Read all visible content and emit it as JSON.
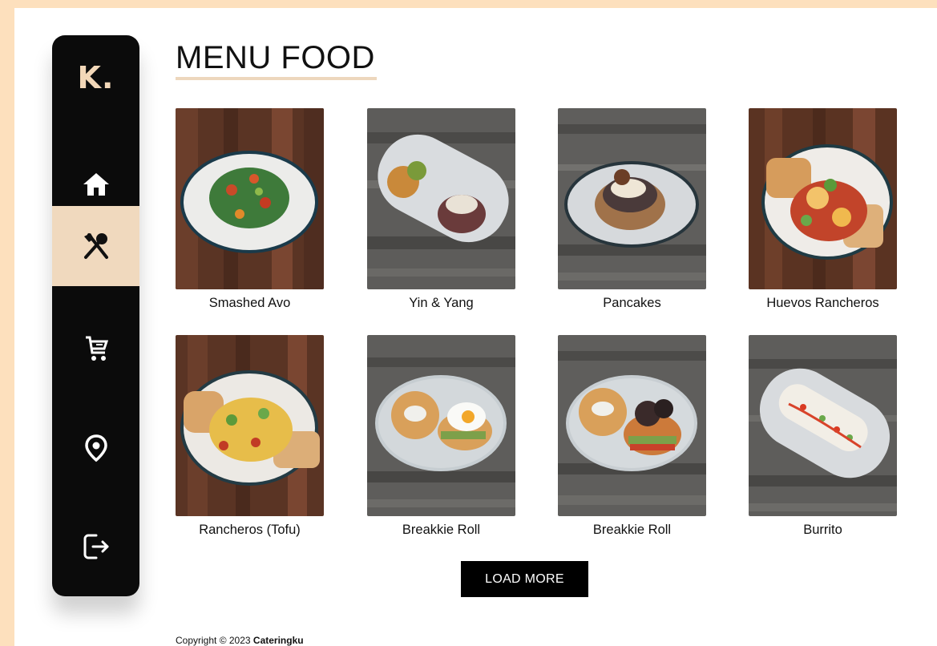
{
  "brand": {
    "logo_text": "K."
  },
  "sidebar": {
    "items": [
      {
        "label": "Home",
        "icon": "home-icon",
        "active": false
      },
      {
        "label": "Menu",
        "icon": "fork-spoon-icon",
        "active": true
      },
      {
        "label": "Cart",
        "icon": "cart-icon",
        "active": false
      },
      {
        "label": "Location",
        "icon": "location-pin-icon",
        "active": false
      },
      {
        "label": "Logout",
        "icon": "logout-icon",
        "active": false
      }
    ]
  },
  "main": {
    "title": "MENU FOOD",
    "menu_items": [
      {
        "name": "Smashed Avo"
      },
      {
        "name": "Yin & Yang"
      },
      {
        "name": "Pancakes"
      },
      {
        "name": "Huevos Rancheros"
      },
      {
        "name": "Rancheros (Tofu)"
      },
      {
        "name": "Breakkie Roll"
      },
      {
        "name": "Breakkie Roll"
      },
      {
        "name": "Burrito"
      }
    ],
    "load_more_label": "LOAD MORE"
  },
  "footer": {
    "copyright_prefix": "Copyright © 2023",
    "brand_name": "Cateringku"
  },
  "colors": {
    "background": "#fde0bd",
    "sidebar": "#0b0b0b",
    "accent": "#f0d9be",
    "button": "#000000"
  }
}
